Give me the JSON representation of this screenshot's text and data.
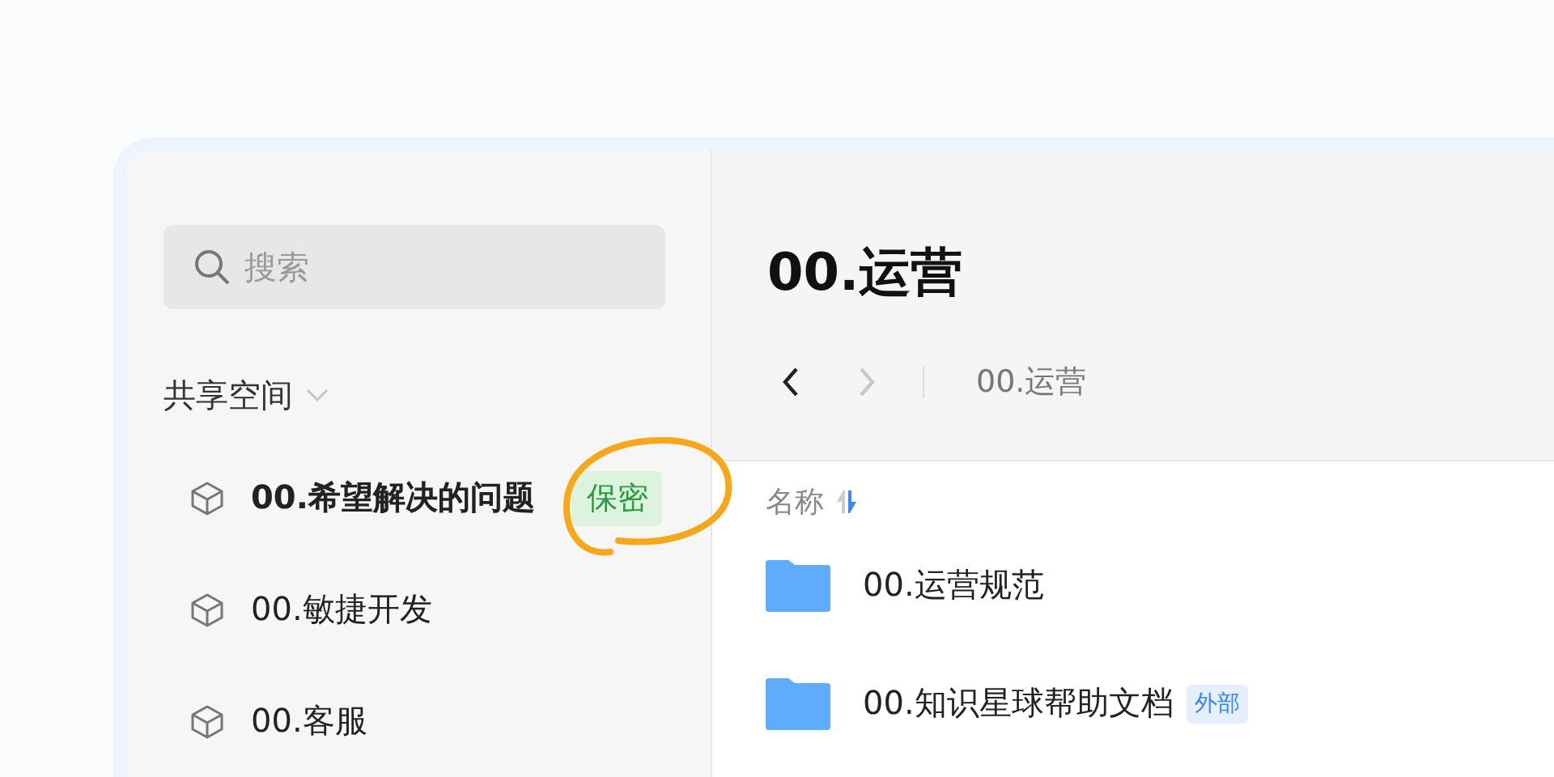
{
  "sidebar": {
    "search": {
      "placeholder": "搜索"
    },
    "section": {
      "title": "共享空间",
      "expanded": true
    },
    "items": [
      {
        "label": "00.希望解决的问题",
        "selected": true,
        "badge": "保密",
        "highlighted": true
      },
      {
        "label": "00.敏捷开发",
        "selected": false
      },
      {
        "label": "00.客服",
        "selected": false
      }
    ]
  },
  "main": {
    "title": "00.运营",
    "nav": [
      {
        "kind": "back",
        "disabled": false
      },
      {
        "kind": "forward",
        "disabled": true
      }
    ],
    "breadcrumb": "00.运营",
    "column": {
      "label": "名称"
    },
    "rows": [
      {
        "name": "00.运营规范"
      },
      {
        "name": "00.知识星球帮助文档",
        "tag": "外部"
      }
    ]
  }
}
